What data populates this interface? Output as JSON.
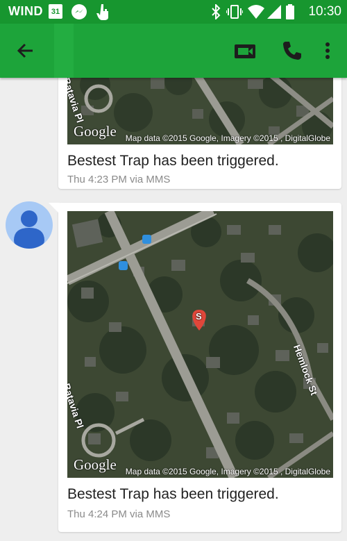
{
  "status_bar": {
    "carrier": "WIND",
    "calendar_day": "31",
    "time": "10:30",
    "icons": [
      "calendar-icon",
      "messenger-icon",
      "hand-icon",
      "bluetooth-icon",
      "vibrate-icon",
      "wifi-icon",
      "signal-icon",
      "battery-icon"
    ]
  },
  "app_bar": {
    "color": "#1da43a",
    "icons": [
      "back-arrow-icon",
      "video-call-icon",
      "phone-call-icon",
      "more-vert-icon"
    ]
  },
  "messages": [
    {
      "map": {
        "brand": "Google",
        "attribution": "Map data ©2015 Google, Imagery ©2015 , DigitalGlobe",
        "street_labels": [
          "Batavia Pl"
        ]
      },
      "text": "Bestest Trap has been triggered.",
      "meta": "Thu 4:23 PM via MMS"
    },
    {
      "map": {
        "brand": "Google",
        "attribution": "Map data ©2015 Google, Imagery ©2015 , DigitalGlobe",
        "street_labels": [
          "Batavia Pl",
          "Hemlock St"
        ],
        "marker_label": "S"
      },
      "text": "Bestest Trap has been triggered.",
      "meta": "Thu 4:24 PM via MMS"
    }
  ]
}
